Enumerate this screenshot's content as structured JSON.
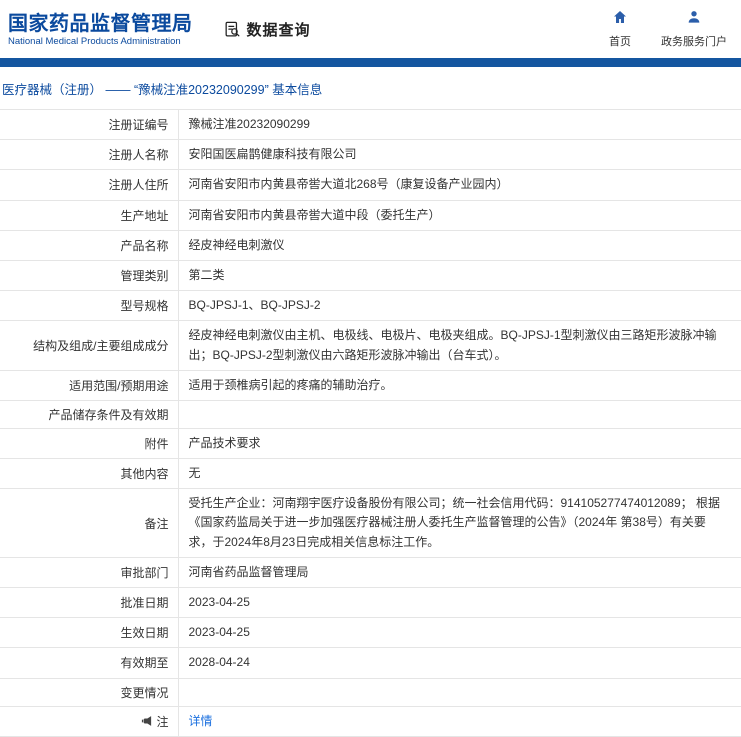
{
  "colors": {
    "brand_blue": "#0b4a9e",
    "bar_blue": "#1456a0",
    "link_blue": "#1a6fdf",
    "icon_blue": "#2b5eaa",
    "border_gray": "#e5e5e5"
  },
  "header": {
    "org_name_cn": "国家药品监督管理局",
    "org_name_en": "National Medical Products Administration",
    "section_title": "数据查询",
    "section_icon": "document-search-icon",
    "nav": [
      {
        "label": "首页",
        "icon": "home-icon"
      },
      {
        "label": "政务服务门户",
        "icon": "user-icon"
      }
    ]
  },
  "breadcrumb": "医疗器械（注册） —— “豫械注准20232090299” 基本信息",
  "table": {
    "rows": [
      {
        "label": "注册证编号",
        "value": "豫械注准20232090299"
      },
      {
        "label": "注册人名称",
        "value": "安阳国医扁鹊健康科技有限公司"
      },
      {
        "label": "注册人住所",
        "value": "河南省安阳市内黄县帝喾大道北268号（康复设备产业园内）"
      },
      {
        "label": "生产地址",
        "value": "河南省安阳市内黄县帝喾大道中段（委托生产）"
      },
      {
        "label": "产品名称",
        "value": "经皮神经电刺激仪"
      },
      {
        "label": "管理类别",
        "value": "第二类"
      },
      {
        "label": "型号规格",
        "value": "BQ-JPSJ-1、BQ-JPSJ-2"
      },
      {
        "label": "结构及组成/主要组成成分",
        "value": "经皮神经电刺激仪由主机、电极线、电极片、电极夹组成。BQ-JPSJ-1型刺激仪由三路矩形波脉冲输出；BQ-JPSJ-2型刺激仪由六路矩形波脉冲输出（台车式）。"
      },
      {
        "label": "适用范围/预期用途",
        "value": "适用于颈椎病引起的疼痛的辅助治疗。"
      },
      {
        "label": "产品储存条件及有效期",
        "value": ""
      },
      {
        "label": "附件",
        "value": "产品技术要求"
      },
      {
        "label": "其他内容",
        "value": "无"
      },
      {
        "label": "备注",
        "value": "受托生产企业：河南翔宇医疗设备股份有限公司；统一社会信用代码：914105277474012089； 根据《国家药监局关于进一步加强医疗器械注册人委托生产监督管理的公告》（2024年 第38号）有关要求，于2024年8月23日完成相关信息标注工作。"
      },
      {
        "label": "审批部门",
        "value": "河南省药品监督管理局"
      },
      {
        "label": "批准日期",
        "value": "2023-04-25"
      },
      {
        "label": "生效日期",
        "value": "2023-04-25"
      },
      {
        "label": "有效期至",
        "value": "2028-04-24"
      },
      {
        "label": "变更情况",
        "value": ""
      },
      {
        "label": "注",
        "label_icon": "megaphone-icon",
        "value": "详情",
        "value_is_link": true
      }
    ]
  }
}
